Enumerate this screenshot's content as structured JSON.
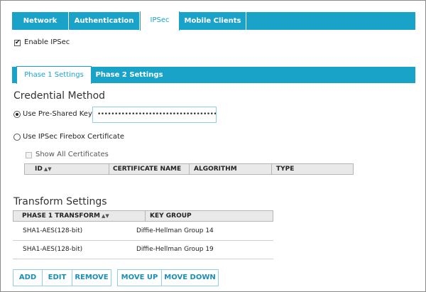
{
  "tabs": [
    {
      "label": "Network"
    },
    {
      "label": "Authentication"
    },
    {
      "label": "IPSec"
    },
    {
      "label": "Mobile Clients"
    }
  ],
  "enable_ipsec": {
    "label": "Enable IPSec",
    "checked": true
  },
  "phase_tabs": [
    {
      "label": "Phase 1 Settings"
    },
    {
      "label": "Phase 2 Settings"
    }
  ],
  "credential": {
    "title": "Credential Method",
    "psk_label": "Use Pre-Shared Key",
    "psk_value": "•••••••••••••••••••••••••••••••••••••",
    "cert_label": "Use IPSec Firebox Certificate",
    "show_all_label": "Show All Certificates",
    "cert_table_headers": [
      "ID",
      "CERTIFICATE NAME",
      "ALGORITHM",
      "TYPE"
    ]
  },
  "transform": {
    "title": "Transform Settings",
    "headers": [
      "PHASE 1 TRANSFORM",
      "KEY GROUP"
    ],
    "rows": [
      {
        "transform": "SHA1-AES(128-bit)",
        "key_group": "Diffie-Hellman Group 14"
      },
      {
        "transform": "SHA1-AES(128-bit)",
        "key_group": "Diffie-Hellman Group 19"
      }
    ]
  },
  "buttons": {
    "add": "ADD",
    "edit": "EDIT",
    "remove": "REMOVE",
    "move_up": "MOVE UP",
    "move_down": "MOVE DOWN"
  },
  "colors": {
    "accent": "#1aa3c9",
    "border": "#8fd0e6"
  }
}
